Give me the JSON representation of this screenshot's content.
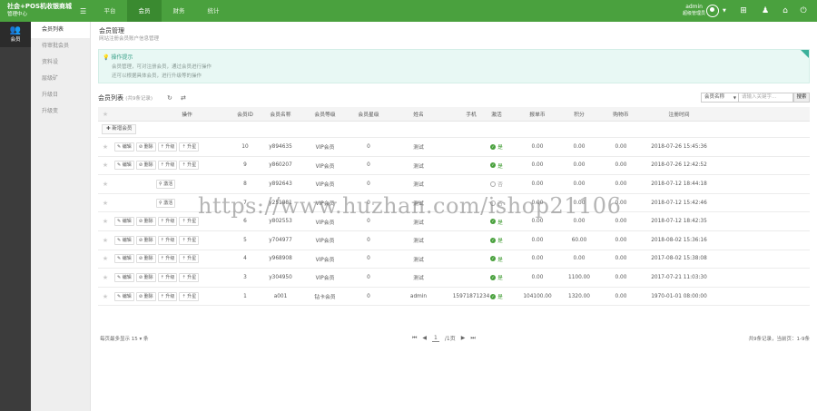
{
  "header": {
    "brand_title": "社会+POS机收银商城",
    "brand_sub": "管理中心",
    "menu_toggle_icon": "hamburger-icon",
    "nav": [
      "平台",
      "会员",
      "财务",
      "统计"
    ],
    "active_nav": 1,
    "user_name": "admin",
    "user_role": "超级管理员"
  },
  "leftbar": {
    "label": "会员",
    "icon": "users-icon"
  },
  "submenu": {
    "items": [
      "会员列表",
      "待审批会员",
      "资料设",
      "层级矿",
      "升级日",
      "升级变"
    ],
    "active": 0
  },
  "page": {
    "title": "会员管理",
    "subtitle": "网站注册会员账户信息管理"
  },
  "tips": {
    "head": "操作提示",
    "lines": [
      "会员管理，可对注册会员，通过会员进行操作",
      "还可以根据具体会员，进行升级等的操作"
    ]
  },
  "list": {
    "title": "会员列表",
    "count": "(共9条记录)",
    "search_field": "会员名称",
    "search_placeholder": "请输入关键字...",
    "search_button": "搜索",
    "add_button": "新增会员"
  },
  "table": {
    "columns": [
      "操作",
      "会员ID",
      "会员名称",
      "会员等级",
      "会员星级",
      "姓名",
      "手机",
      "激活",
      "报单币",
      "积分",
      "购物币",
      "注册时间"
    ],
    "btn_edit": "编辑",
    "btn_delete": "删除",
    "btn_up": "升级",
    "btn_star": "升星",
    "btn_activate": "激活",
    "active_yes": "是",
    "active_no": "否",
    "rows": [
      {
        "ops": "full",
        "id": "10",
        "name": "y894635",
        "level": "VIP会员",
        "star": "0",
        "real": "测试",
        "phone": "",
        "active": true,
        "bd": "0.00",
        "jf": "0.00",
        "gw": "0.00",
        "time": "2018-07-26 15:45:36"
      },
      {
        "ops": "full",
        "id": "9",
        "name": "y860207",
        "level": "VIP会员",
        "star": "0",
        "real": "测试",
        "phone": "",
        "active": true,
        "bd": "0.00",
        "jf": "0.00",
        "gw": "0.00",
        "time": "2018-07-26 12:42:52"
      },
      {
        "ops": "activate",
        "id": "8",
        "name": "y892643",
        "level": "VIP会员",
        "star": "0",
        "real": "测试",
        "phone": "",
        "active": false,
        "bd": "0.00",
        "jf": "0.00",
        "gw": "0.00",
        "time": "2018-07-12 18:44:18"
      },
      {
        "ops": "activate",
        "id": "7",
        "name": "y251881",
        "level": "VIP会员",
        "star": "0",
        "real": "测试",
        "phone": "",
        "active": false,
        "bd": "0.00",
        "jf": "0.00",
        "gw": "0.00",
        "time": "2018-07-12 15:42:46"
      },
      {
        "ops": "full",
        "id": "6",
        "name": "y802553",
        "level": "VIP会员",
        "star": "0",
        "real": "测试",
        "phone": "",
        "active": true,
        "bd": "0.00",
        "jf": "0.00",
        "gw": "0.00",
        "time": "2018-07-12 18:42:35"
      },
      {
        "ops": "full",
        "id": "5",
        "name": "y704977",
        "level": "VIP会员",
        "star": "0",
        "real": "测试",
        "phone": "",
        "active": true,
        "bd": "0.00",
        "jf": "60.00",
        "gw": "0.00",
        "time": "2018-08-02 15:36:16"
      },
      {
        "ops": "full",
        "id": "4",
        "name": "y968908",
        "level": "VIP会员",
        "star": "0",
        "real": "测试",
        "phone": "",
        "active": true,
        "bd": "0.00",
        "jf": "0.00",
        "gw": "0.00",
        "time": "2017-08-02 15:38:08"
      },
      {
        "ops": "full",
        "id": "3",
        "name": "y304950",
        "level": "VIP会员",
        "star": "0",
        "real": "测试",
        "phone": "",
        "active": true,
        "bd": "0.00",
        "jf": "1100.00",
        "gw": "0.00",
        "time": "2017-07-21 11:03:30"
      },
      {
        "ops": "full",
        "id": "1",
        "name": "a001",
        "level": "钻卡会员",
        "star": "0",
        "real": "admin",
        "phone": "15971871234",
        "active": true,
        "bd": "104100.00",
        "jf": "1320.00",
        "gw": "0.00",
        "time": "1970-01-01 08:00:00"
      }
    ]
  },
  "pager": {
    "left": "每页最多显示 15",
    "left_suffix": "条",
    "page": "1",
    "of": "/1页",
    "right": "共9条记录，当前页：1-9条"
  },
  "watermark": "https://www.huzhan.com/ishop21106",
  "colors": {
    "brand": "#4aa13e",
    "ok": "#4aa13e",
    "tips_bg": "#e8f8f4"
  }
}
